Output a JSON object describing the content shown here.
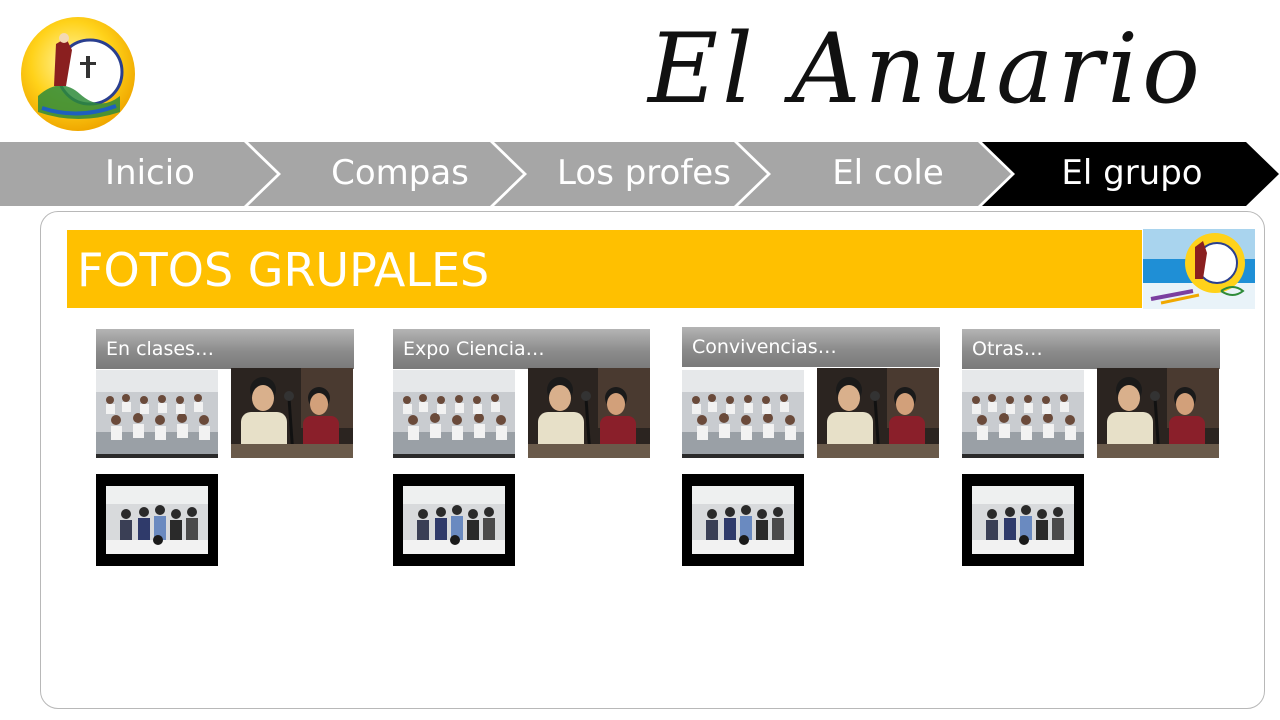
{
  "header": {
    "title": "El Anuario",
    "logo_icon": "school-crest-icon"
  },
  "nav": {
    "items": [
      {
        "label": "Inicio",
        "active": false
      },
      {
        "label": "Compas",
        "active": false
      },
      {
        "label": "Los profes",
        "active": false
      },
      {
        "label": "El cole",
        "active": false
      },
      {
        "label": "El grupo",
        "active": true
      }
    ],
    "colors": {
      "inactive": "#a6a6a6",
      "active": "#000000"
    }
  },
  "section": {
    "title": "FOTOS GRUPALES",
    "accent": "#ffc000",
    "badge_icon": "school-anniversary-badge-icon"
  },
  "categories": [
    {
      "label": "En clases…",
      "photos": [
        "classroom-children-photo",
        "students-microphone-photo",
        "group-standing-photo"
      ]
    },
    {
      "label": "Expo Ciencia…",
      "photos": [
        "classroom-children-photo",
        "students-microphone-photo",
        "group-standing-photo"
      ]
    },
    {
      "label": "Convivencias…",
      "photos": [
        "classroom-children-photo",
        "students-microphone-photo",
        "group-standing-photo"
      ]
    },
    {
      "label": "Otras…",
      "photos": [
        "classroom-children-photo",
        "students-microphone-photo",
        "group-standing-photo"
      ]
    }
  ]
}
